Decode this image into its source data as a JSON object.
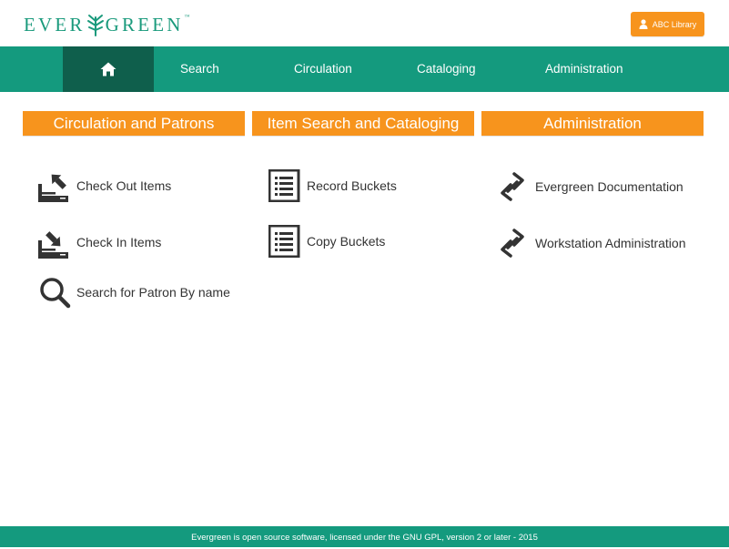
{
  "header": {
    "logo_left": "EVER",
    "logo_right": "GREEN",
    "logo_tm": "™",
    "library_button_label": "ABC Library"
  },
  "nav": {
    "home_icon": "home-icon",
    "items": [
      {
        "label": "Search"
      },
      {
        "label": "Circulation"
      },
      {
        "label": "Cataloging"
      },
      {
        "label": "Administration"
      }
    ]
  },
  "sections": [
    {
      "title": "Circulation and Patrons",
      "links": [
        {
          "label": "Check Out Items",
          "icon": "check-out-icon"
        },
        {
          "label": "Check In Items",
          "icon": "check-in-icon"
        },
        {
          "label": "Search for Patron By name",
          "icon": "search-icon"
        }
      ]
    },
    {
      "title": "Item Search and Cataloging",
      "links": [
        {
          "label": "Record Buckets",
          "icon": "list-icon"
        },
        {
          "label": "Copy Buckets",
          "icon": "list-icon"
        }
      ]
    },
    {
      "title": "Administration",
      "links": [
        {
          "label": "Evergreen Documentation",
          "icon": "link-icon"
        },
        {
          "label": "Workstation Administration",
          "icon": "link-icon"
        }
      ]
    }
  ],
  "footer": {
    "text": "Evergreen is open source software, licensed under the GNU GPL, version 2 or later - 2015"
  },
  "colors": {
    "brand_green": "#149a7e",
    "nav_active": "#0f5f4c",
    "accent_orange": "#f7941d",
    "icon_dark": "#333333"
  }
}
